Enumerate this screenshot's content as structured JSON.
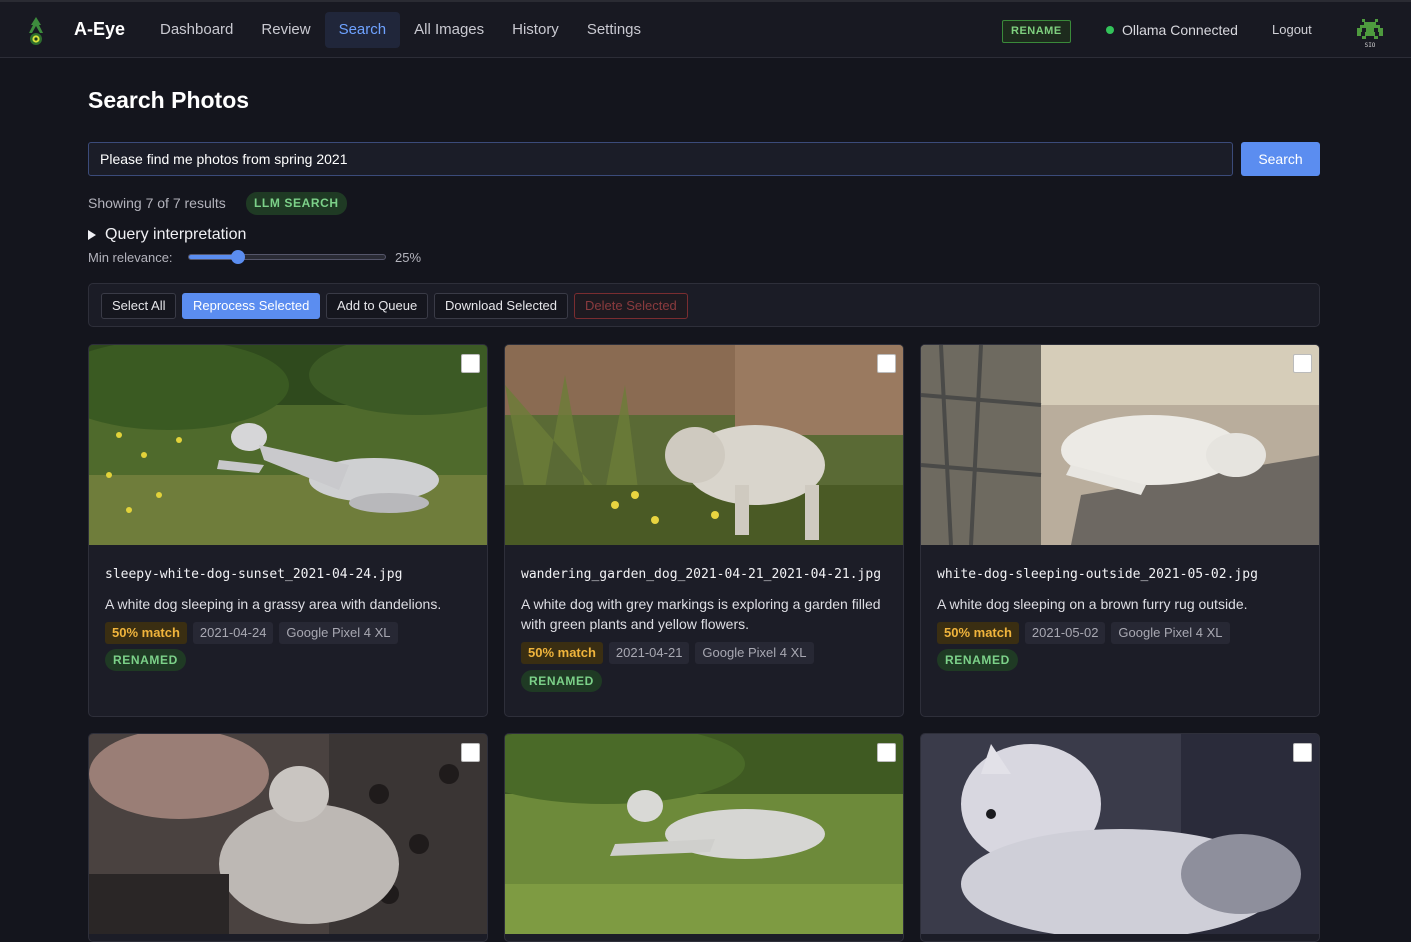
{
  "app": {
    "brand": "A-Eye",
    "rename_badge": "RENAME",
    "status_text": "Ollama Connected",
    "logout_label": "Logout",
    "accent_color": "#5b8df0"
  },
  "nav": {
    "items": [
      {
        "label": "Dashboard"
      },
      {
        "label": "Review"
      },
      {
        "label": "Search"
      },
      {
        "label": "All Images"
      },
      {
        "label": "History"
      },
      {
        "label": "Settings"
      }
    ],
    "active": "Search"
  },
  "page": {
    "title": "Search Photos",
    "search_value": "Please find me photos from spring 2021",
    "search_button": "Search",
    "results_text": "Showing 7 of 7 results",
    "search_mode_badge": "LLM SEARCH",
    "query_interpretation_label": "Query interpretation",
    "min_relevance_label": "Min relevance:",
    "min_relevance_value": "25%",
    "min_relevance_fraction": 0.25
  },
  "toolbar": {
    "select_all": "Select All",
    "reprocess_selected": "Reprocess Selected",
    "add_to_queue": "Add to Queue",
    "download_selected": "Download Selected",
    "delete_selected": "Delete Selected"
  },
  "results": [
    {
      "filename": "sleepy-white-dog-sunset_2021-04-24.jpg",
      "description": "A white dog sleeping in a grassy area with dandelions.",
      "match": "50% match",
      "date": "2021-04-24",
      "camera": "Google Pixel 4 XL",
      "status": "RENAMED"
    },
    {
      "filename": "wandering_garden_dog_2021-04-21_2021-04-21.jpg",
      "description": "A white dog with grey markings is exploring a garden filled with green plants and yellow flowers.",
      "match": "50% match",
      "date": "2021-04-21",
      "camera": "Google Pixel 4 XL",
      "status": "RENAMED"
    },
    {
      "filename": "white-dog-sleeping-outside_2021-05-02.jpg",
      "description": "A white dog sleeping on a brown furry rug outside.",
      "match": "50% match",
      "date": "2021-05-02",
      "camera": "Google Pixel 4 XL",
      "status": "RENAMED"
    }
  ]
}
